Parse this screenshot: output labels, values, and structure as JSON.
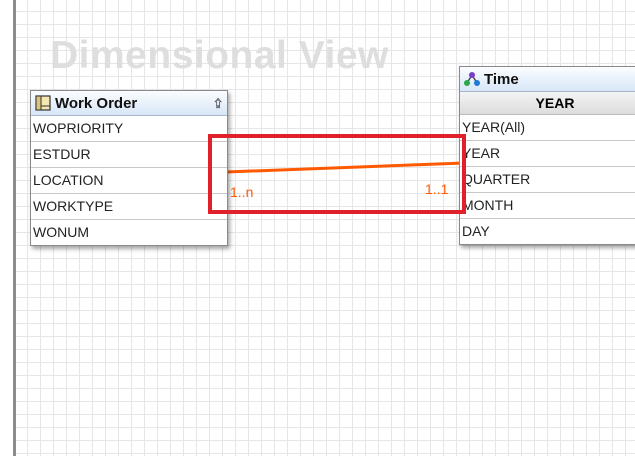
{
  "canvas": {
    "title": "Dimensional View"
  },
  "work_order": {
    "title": "Work Order",
    "icon": "table-icon",
    "fields": [
      "WOPRIORITY",
      "ESTDUR",
      "LOCATION",
      "WORKTYPE",
      "WONUM"
    ]
  },
  "time": {
    "title": "Time",
    "icon": "hierarchy-icon",
    "level_header": "YEAR",
    "fields": [
      "YEAR(All)",
      "YEAR",
      "QUARTER",
      "MONTH",
      "DAY"
    ]
  },
  "relationship": {
    "left_cardinality": "1..n",
    "right_cardinality": "1..1",
    "line_color": "#ff5a00"
  },
  "highlight": {
    "color": "#e0202a"
  }
}
